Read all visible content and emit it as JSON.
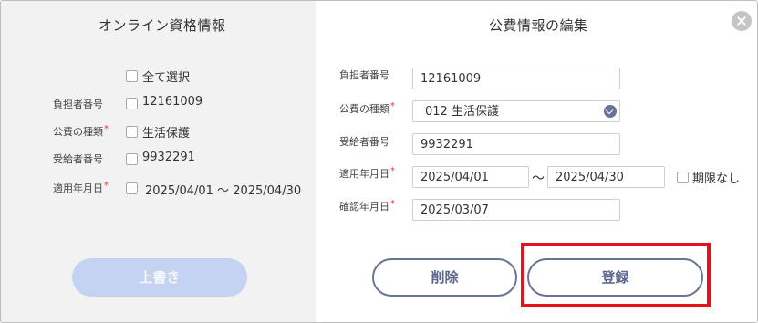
{
  "left": {
    "title": "オンライン資格情報",
    "select_all": "全て選択",
    "rows": [
      {
        "label": "負担者番号",
        "required": "",
        "value": "12161009"
      },
      {
        "label": "公費の種類",
        "required": "*",
        "value": "生活保護"
      },
      {
        "label": "受給者番号",
        "required": "",
        "value": "9932291"
      },
      {
        "label": "適用年月日",
        "required": "*",
        "value": "2025/04/01 ～ 2025/04/30"
      }
    ],
    "overwrite_button": "上書き"
  },
  "right": {
    "title": "公費情報の編集",
    "fields": {
      "burden_number": {
        "label": "負担者番号",
        "required": "",
        "value": "12161009"
      },
      "public_type": {
        "label": "公費の種類",
        "required": "*",
        "value": "012 生活保護"
      },
      "recipient_number": {
        "label": "受給者番号",
        "required": "",
        "value": "9932291"
      },
      "apply_date": {
        "label": "適用年月日",
        "required": "*",
        "from": "2025/04/01",
        "separator": "～",
        "to": "2025/04/30"
      },
      "confirm_date": {
        "label": "確認年月日",
        "required": "*",
        "value": "2025/03/07"
      }
    },
    "no_limit_label": "期限なし",
    "delete_button": "削除",
    "register_button": "登録"
  },
  "colors": {
    "left_panel": "#f2f2f2",
    "required_mark": "#e53935",
    "button_outline": "#6a7396",
    "disabled_button": "#c5d3f3",
    "highlight": "#e8101c"
  },
  "icons": {
    "close": "close-icon",
    "select": "chevron-down-icon"
  }
}
